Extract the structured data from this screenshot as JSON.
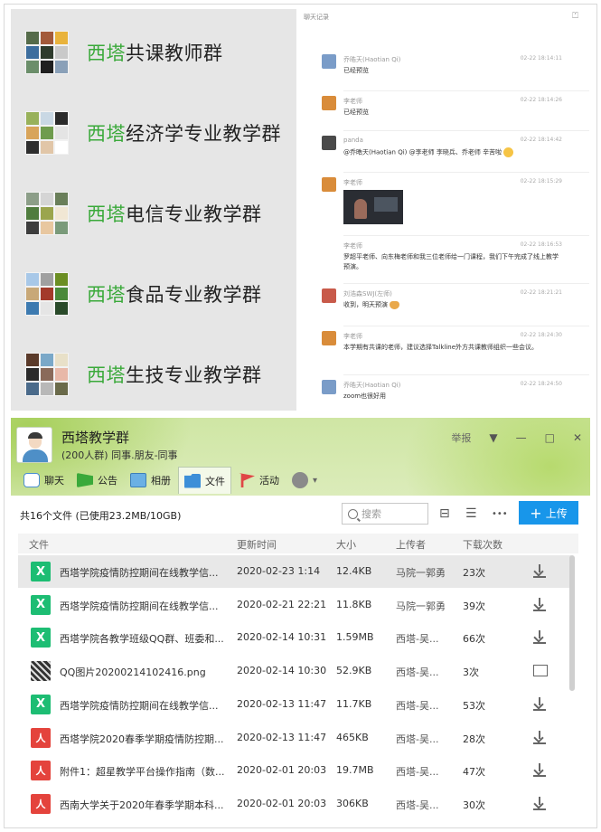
{
  "groups": [
    {
      "prefix": "西塔",
      "name": "共课教师群",
      "colors": [
        "#556b4a",
        "#a35a3a",
        "#e9b33c",
        "#3d6e9e",
        "#2e3b2c",
        "#c9c9c9",
        "#6b8e6a",
        "#1f1f1f",
        "#8aa0b8"
      ]
    },
    {
      "prefix": "西塔",
      "name": "经济学专业教学群",
      "colors": [
        "#98b15a",
        "#c9d8e4",
        "#2b2b2b",
        "#d8a45a",
        "#6f9c4e",
        "#e4e4e4",
        "#2e2e2e",
        "#e1c6a8",
        "#ffffff"
      ]
    },
    {
      "prefix": "西塔",
      "name": "电信专业教学群",
      "colors": [
        "#8c9e88",
        "#d5d5d5",
        "#6a7f5a",
        "#4f7c3e",
        "#9ba54d",
        "#f1e7d4",
        "#3d3d3d",
        "#e8c7a0",
        "#7a9a7a"
      ]
    },
    {
      "prefix": "西塔",
      "name": "食品专业教学群",
      "colors": [
        "#a8c8e8",
        "#a0a0a0",
        "#6b8e23",
        "#c8a878",
        "#a33a2a",
        "#4a8a3a",
        "#3d7ab0",
        "#e5e5e5",
        "#2a4a2a"
      ]
    },
    {
      "prefix": "西塔",
      "name": "生技专业教学群",
      "colors": [
        "#5a3a2a",
        "#7aa8c8",
        "#e8e0c8",
        "#2a2a2a",
        "#8a6a5a",
        "#e8b8a8",
        "#4a6a8a",
        "#b8b8b8",
        "#6a6a4a"
      ]
    }
  ],
  "chat": {
    "header": "聊天记录",
    "export_icon": "⏍",
    "messages": [
      {
        "name": "乔晧天(Haotian Qi)",
        "time": "02-22 18:14:11",
        "text": "已经预览",
        "avatar": "#7a9cc8"
      },
      {
        "name": "李老师",
        "time": "02-22 18:14:26",
        "text": "已经预览",
        "avatar": "#d98c3a"
      },
      {
        "name": "panda",
        "time": "02-22 18:14:42",
        "text": "@乔晧天(Haotian Qi) @李老师 李晓兵、乔老师 辛苦啦",
        "avatar": "#4a4a4a"
      },
      {
        "name": "李老师",
        "time": "02-22 18:15:29",
        "text": "",
        "avatar": "#d98c3a"
      },
      {
        "name": "李老师",
        "time": "02-22 18:16:53",
        "text": "罗超平老师、向东梅老师和我三位老师给一门课程，我们下午完成了线上教学预演。",
        "avatar": ""
      },
      {
        "name": "刘浩森SWJ(左师)",
        "time": "02-22 18:21:21",
        "text": "收到，明天预演",
        "avatar": "#c85a4a"
      },
      {
        "name": "李老师",
        "time": "02-22 18:24:30",
        "text": "本学期有共课的老师，建议选择Talkline外方共课教师组织一些会议。",
        "avatar": "#d98c3a"
      },
      {
        "name": "乔晧天(Haotian Qi)",
        "time": "02-22 18:24:50",
        "text": "zoom也很好用",
        "avatar": "#7a9cc8"
      }
    ]
  },
  "qq": {
    "title": "西塔教学群",
    "subtitle": "(200人群) 同事.朋友-同事",
    "window_controls": {
      "report": "举报",
      "dropdown": "▼",
      "minimize": "—",
      "maximize": "□",
      "close": "✕"
    },
    "tabs": [
      {
        "label": "聊天",
        "icon": "chat-bubble-icon",
        "cls": "ic-chat"
      },
      {
        "label": "公告",
        "icon": "notice-flag-icon",
        "cls": "ic-notice"
      },
      {
        "label": "相册",
        "icon": "album-icon",
        "cls": "ic-album"
      },
      {
        "label": "文件",
        "icon": "folder-icon",
        "cls": "ic-file"
      },
      {
        "label": "活动",
        "icon": "activity-flag-icon",
        "cls": "ic-activity"
      }
    ],
    "settings_arrow": "▾",
    "summary": "共16个文件 (已使用23.2MB/10GB)",
    "search_placeholder": "搜索",
    "upload_label": "上传",
    "upload_plus": "+",
    "toolbar_icons": {
      "inbox": "⊟",
      "list": "☰",
      "more": "•••"
    },
    "columns": {
      "file": "文件",
      "time": "更新时间",
      "size": "大小",
      "owner": "上传者",
      "count": "下载次数"
    },
    "files": [
      {
        "type": "xlsx",
        "icon_text": "X",
        "name": "西塔学院疫情防控期间在线教学信...",
        "time": "2020-02-23 1:14",
        "size": "12.4KB",
        "owner": "马院一郭勇",
        "count": "23次",
        "action": "download"
      },
      {
        "type": "xlsx",
        "icon_text": "X",
        "name": "西塔学院疫情防控期间在线教学信...",
        "time": "2020-02-21 22:21",
        "size": "11.8KB",
        "owner": "马院一郭勇",
        "count": "39次",
        "action": "download"
      },
      {
        "type": "xlsx",
        "icon_text": "X",
        "name": "西塔学院各教学班级QQ群、班委和...",
        "time": "2020-02-14 10:31",
        "size": "1.59MB",
        "owner": "西塔-吴...",
        "count": "66次",
        "action": "download"
      },
      {
        "type": "img",
        "icon_text": "",
        "name": "QQ图片20200214102416.png",
        "time": "2020-02-14 10:30",
        "size": "52.9KB",
        "owner": "西塔-吴...",
        "count": "3次",
        "action": "folder"
      },
      {
        "type": "xlsx",
        "icon_text": "X",
        "name": "西塔学院疫情防控期间在线教学信...",
        "time": "2020-02-13 11:47",
        "size": "11.7KB",
        "owner": "西塔-吴...",
        "count": "53次",
        "action": "download"
      },
      {
        "type": "pdf",
        "icon_text": "人",
        "name": "西塔学院2020春季学期疫情防控期...",
        "time": "2020-02-13 11:47",
        "size": "465KB",
        "owner": "西塔-吴...",
        "count": "28次",
        "action": "download"
      },
      {
        "type": "pdf",
        "icon_text": "人",
        "name": "附件1：超星教学平台操作指南（数...",
        "time": "2020-02-01 20:03",
        "size": "19.7MB",
        "owner": "西塔-吴...",
        "count": "47次",
        "action": "download"
      },
      {
        "type": "pdf",
        "icon_text": "人",
        "name": "西南大学关于2020年春季学期本科...",
        "time": "2020-02-01 20:03",
        "size": "306KB",
        "owner": "西塔-吴...",
        "count": "30次",
        "action": "download"
      }
    ]
  }
}
